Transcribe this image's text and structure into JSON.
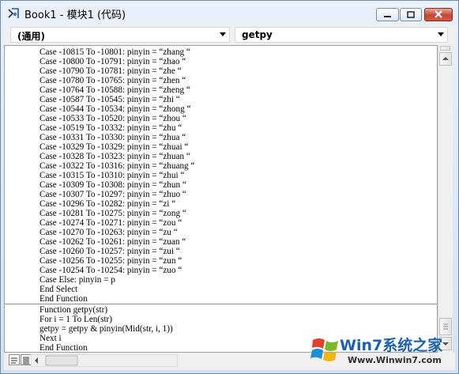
{
  "window": {
    "title": "Book1 - 模块1 (代码)"
  },
  "toolbar": {
    "object_combo": "(通用)",
    "procedure_combo": "getpy"
  },
  "code_upper": [
    "Case -10815 To -10801: pinyin = “zhang “",
    "Case -10800 To -10791: pinyin = “zhao “",
    "Case -10790 To -10781: pinyin = “zhe “",
    "Case -10780 To -10765: pinyin = “zhen “",
    "Case -10764 To -10588: pinyin = “zheng “",
    "Case -10587 To -10545: pinyin = “zhi “",
    "Case -10544 To -10534: pinyin = “zhong “",
    "Case -10533 To -10520: pinyin = “zhou “",
    "Case -10519 To -10332: pinyin = “zhu “",
    "Case -10331 To -10330: pinyin = “zhua “",
    "Case -10329 To -10329: pinyin = “zhuai “",
    "Case -10328 To -10323: pinyin = “zhuan “",
    "Case -10322 To -10316: pinyin = “zhuang “",
    "Case -10315 To -10310: pinyin = “zhui “",
    "Case -10309 To -10308: pinyin = “zhun “",
    "Case -10307 To -10297: pinyin = “zhuo “",
    "Case -10296 To -10282: pinyin = “zi “",
    "Case -10281 To -10275: pinyin = “zong “",
    "Case -10274 To -10271: pinyin = “zou “",
    "Case -10270 To -10263: pinyin = “zu “",
    "Case -10262 To -10261: pinyin = “zuan “",
    "Case -10260 To -10257: pinyin = “zui “",
    "Case -10256 To -10255: pinyin = “zun “",
    "Case -10254 To -10254: pinyin = “zuo “",
    "Case Else: pinyin = p",
    "End Select",
    "End Function"
  ],
  "code_lower": [
    "Function getpy(str)",
    "For i = 1 To Len(str)",
    "getpy = getpy & pinyin(Mid(str, i, 1))",
    "Next i",
    "End Function"
  ],
  "watermark": {
    "title": "Win7系统之家",
    "url": "Www.Winwin7.com"
  },
  "colors": {
    "watermark_blue": "#1d5fb4",
    "close_red": "#c64633"
  }
}
